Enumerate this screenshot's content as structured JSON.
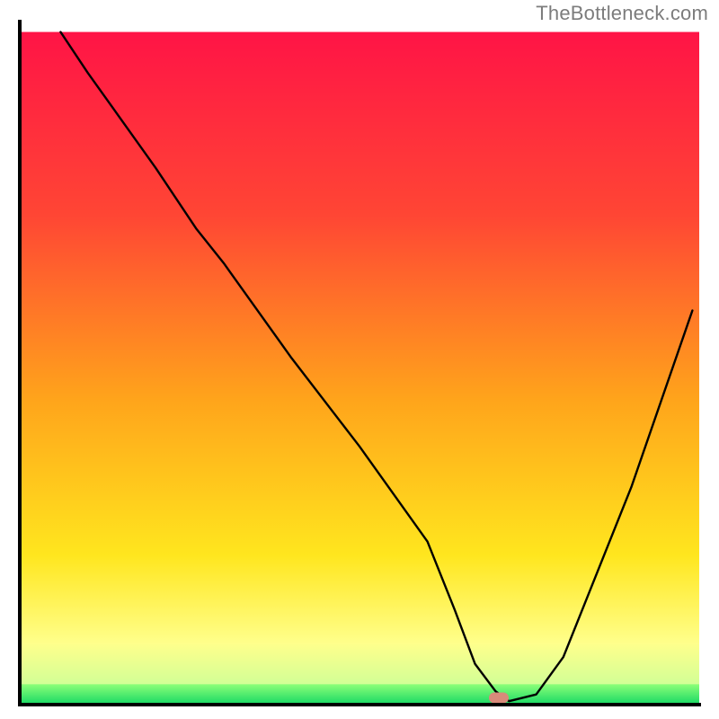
{
  "watermark": "TheBottleneck.com",
  "chart_data": {
    "type": "line",
    "title": "",
    "xlabel": "",
    "ylabel": "",
    "xlim": [
      0,
      100
    ],
    "ylim": [
      0,
      100
    ],
    "x": [
      6,
      10,
      20,
      26,
      30,
      40,
      50,
      60,
      64,
      67,
      70,
      72,
      76,
      80,
      90,
      99
    ],
    "values": [
      99,
      93,
      79,
      70,
      65,
      51,
      38,
      24,
      14,
      6,
      2,
      0.5,
      1.5,
      7,
      32,
      58
    ],
    "marker": {
      "x": 70.5,
      "y": 1.0
    },
    "gradient_bands": [
      {
        "y0": 99,
        "y1": 72,
        "from": "#ff1446",
        "to": "#ff4634"
      },
      {
        "y0": 72,
        "y1": 45,
        "from": "#ff4634",
        "to": "#ffa41b"
      },
      {
        "y0": 45,
        "y1": 22,
        "from": "#ffa41b",
        "to": "#ffe61e"
      },
      {
        "y0": 22,
        "y1": 9,
        "from": "#ffe61e",
        "to": "#ffff8c"
      },
      {
        "y0": 9,
        "y1": 3,
        "from": "#ffff8c",
        "to": "#d2ff96"
      },
      {
        "y0": 3,
        "y1": 0,
        "from": "#8cff78",
        "to": "#14d764"
      }
    ],
    "axis_color": "#000000"
  }
}
